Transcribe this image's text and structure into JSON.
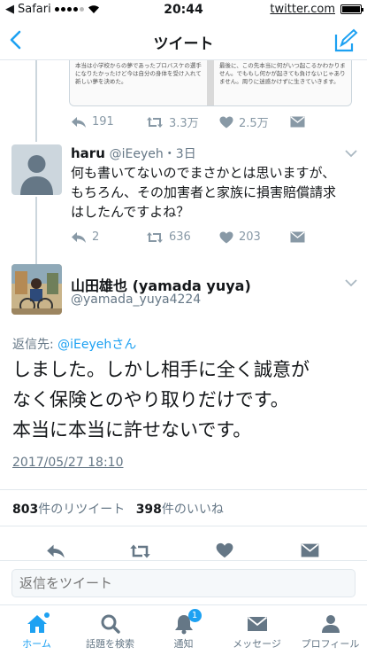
{
  "status_bar": {
    "carrier": "Safari",
    "time": "20:44",
    "site": "twitter.com"
  },
  "nav": {
    "title": "ツイート",
    "back_icon": "chevron-left-icon",
    "compose_icon": "compose-icon"
  },
  "quoted_image": {
    "left_text": "本当は小学校からの夢であったプロバスケの選手になりたかったけど今は自分の身体を受け入れて新しい夢を決めた。",
    "right_text": "最後に、この先本当に何がいつ起こるかわかりません。でももし何かが起きても負けないじゃありません。周りに迷惑かけずに生きていきます。"
  },
  "prev_tweet_actions": {
    "replies": "191",
    "retweets": "3.3万",
    "likes": "2.5万"
  },
  "reply_tweet": {
    "name": "haru",
    "handle": "@iEeyeh",
    "age": "3日",
    "text": "何も書いてないのでまさかとは思いますが、もちろん、その加害者と家族に損害賠償請求はしたんですよね？",
    "replies": "2",
    "retweets": "636",
    "likes": "203"
  },
  "main_tweet": {
    "name": "山田雄也 (yamada yuya)",
    "handle": "@yamada_yuya4224",
    "reply_prefix": "返信先: ",
    "reply_mention": "@iEeyehさん",
    "text_lines": [
      "しました。しかし相手に全く誠意が",
      "なく保険とのやり取りだけです。",
      "本当に本当に許せないです。"
    ],
    "timestamp": "2017/05/27 18:10",
    "retweet_count": "803",
    "retweet_label": "件のリツイート",
    "like_count": "398",
    "like_label": "件のいいね"
  },
  "reply_bar": {
    "placeholder": "返信をツイート"
  },
  "tabs": [
    {
      "label": "ホーム",
      "icon": "home-icon",
      "active": true
    },
    {
      "label": "話題を検索",
      "icon": "search-icon"
    },
    {
      "label": "通知",
      "icon": "bell-icon",
      "badge": "1"
    },
    {
      "label": "メッセージ",
      "icon": "envelope-icon"
    },
    {
      "label": "プロフィール",
      "icon": "profile-icon"
    }
  ],
  "colors": {
    "accent": "#1da1f2",
    "text": "#14171a",
    "secondary": "#657786",
    "icon_gray": "#8899a6",
    "divider": "#e1e8ed"
  }
}
